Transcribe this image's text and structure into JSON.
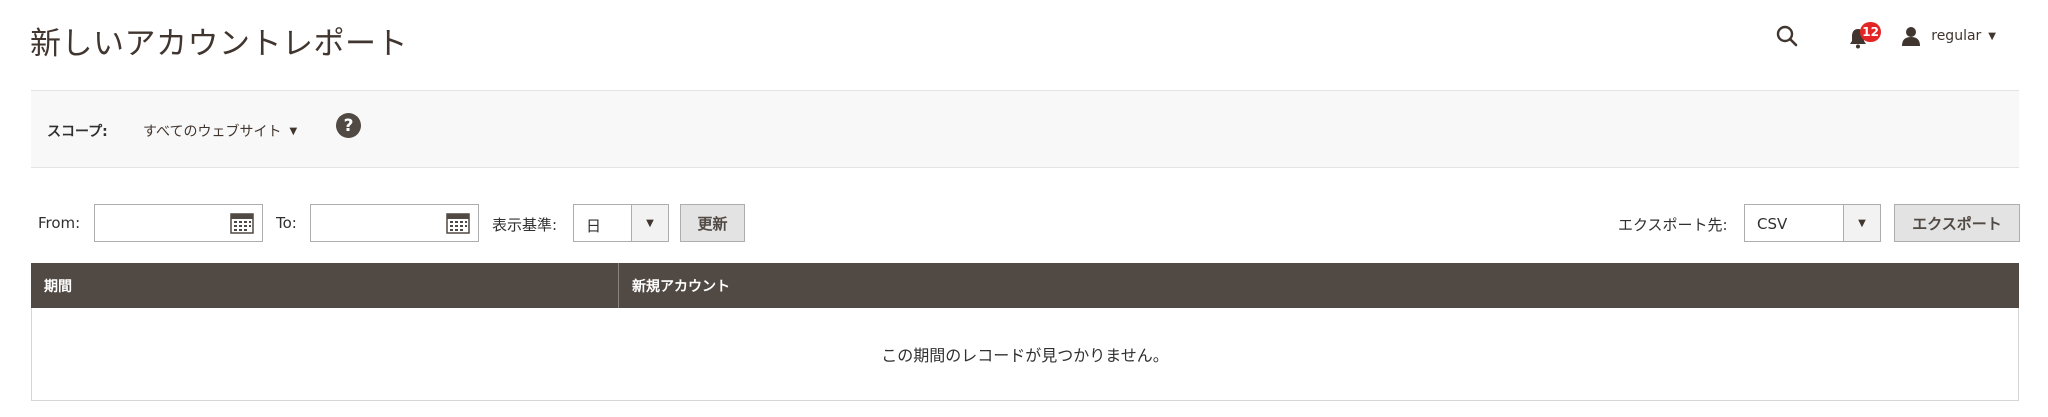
{
  "header": {
    "title": "新しいアカウントレポート",
    "notifications_count": "12",
    "user_name": "regular",
    "icons": {
      "search": "search-icon",
      "notifications": "bell-icon",
      "user": "user-icon"
    }
  },
  "scope": {
    "label": "スコープ:",
    "selected": "すべてのウェブサイト",
    "help_icon": "?"
  },
  "filters": {
    "from_label": "From:",
    "from_value": "",
    "to_label": "To:",
    "to_value": "",
    "period_label": "表示基準:",
    "period_value": "日",
    "refresh_label": "更新",
    "export_label": "エクスポート先:",
    "export_format": "CSV",
    "export_button": "エクスポート"
  },
  "grid": {
    "columns": [
      "期間",
      "新規アカウント"
    ],
    "empty_message": "この期間のレコードが見つかりません。"
  },
  "colors": {
    "header_bg": "#514943",
    "badge": "#e22626",
    "scope_bg": "#f8f8f8"
  }
}
